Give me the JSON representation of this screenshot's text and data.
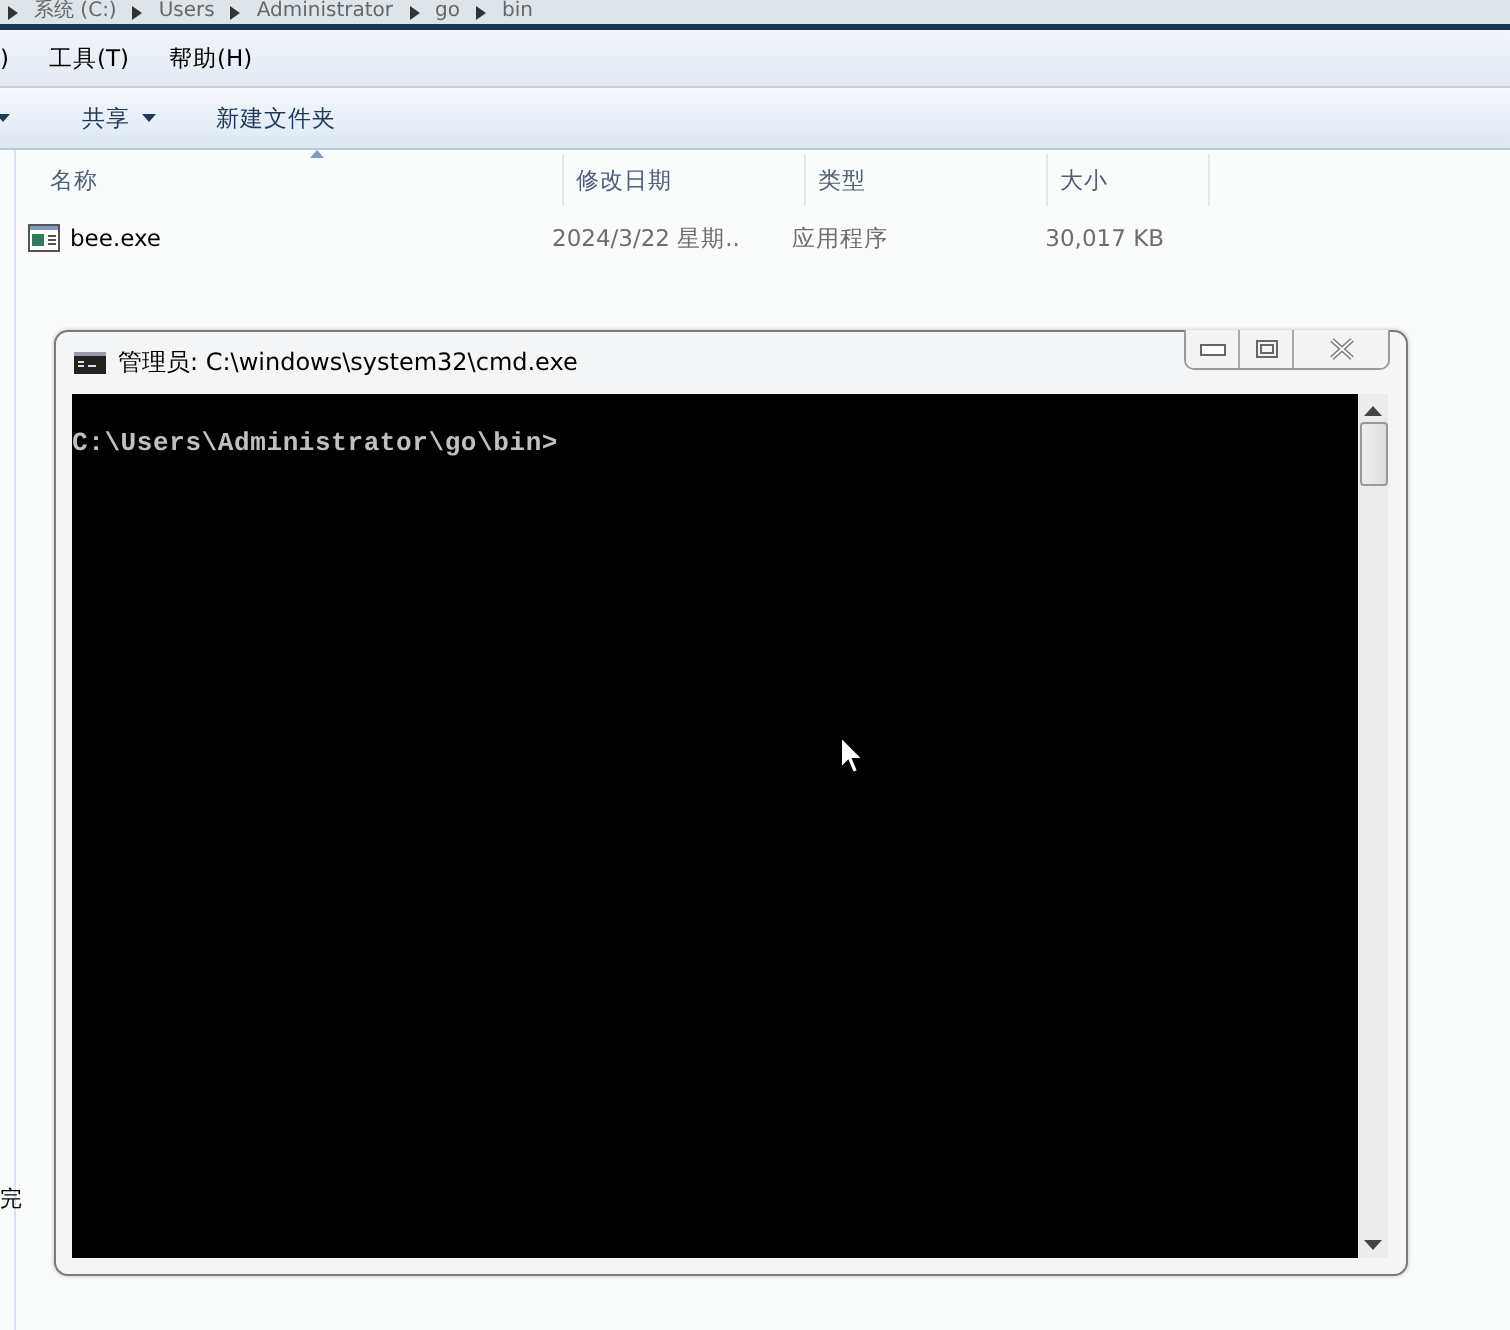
{
  "breadcrumb": [
    "系统 (C:)",
    "Users",
    "Administrator",
    "go",
    "bin"
  ],
  "menu": [
    ")",
    "工具(T)",
    "帮助(H)"
  ],
  "toolbar": [
    {
      "label": "共享",
      "dropdown": true
    },
    {
      "label": "新建文件夹",
      "dropdown": false
    }
  ],
  "columns": [
    {
      "label": "名称",
      "sorted": true
    },
    {
      "label": "修改日期",
      "sorted": false
    },
    {
      "label": "类型",
      "sorted": false
    },
    {
      "label": "大小",
      "sorted": false
    }
  ],
  "rows": [
    {
      "name": "bee.exe",
      "modified": "2024/3/22 星期..",
      "type": "应用程序",
      "size": "30,017 KB"
    }
  ],
  "nav_pane_text": "完",
  "console": {
    "title": "管理员: C:\\windows\\system32\\cmd.exe",
    "lines": [
      "C:\\Users\\Administrator\\go\\bin>"
    ]
  }
}
